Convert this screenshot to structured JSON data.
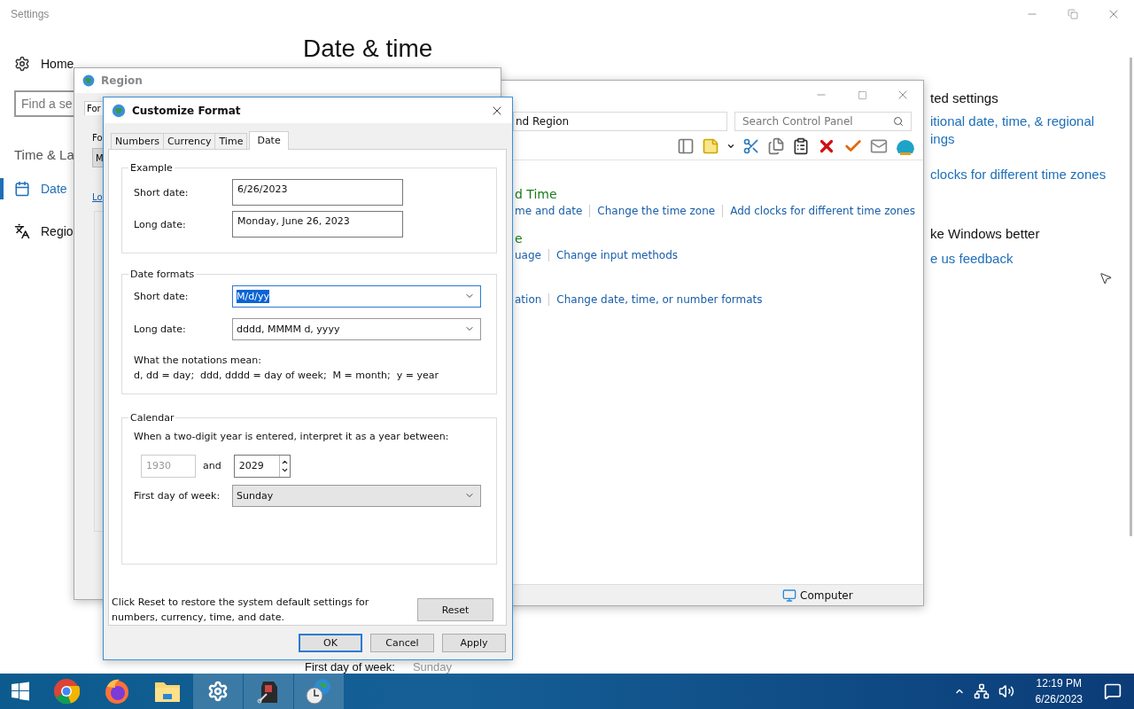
{
  "settings": {
    "title": "Settings",
    "home": "Home",
    "search_placeholder": "Find a se",
    "section": "Time & La",
    "nav": [
      {
        "kind": "calendar",
        "label": "Date",
        "selected": true
      },
      {
        "kind": "language",
        "label": "Regio",
        "selected": false
      }
    ],
    "heading": "Date & time",
    "behind_row": {
      "label": "First day of week:",
      "value": "Sunday"
    },
    "related": {
      "heading": "ted settings",
      "links": [
        "itional date, time, & regional ings",
        "clocks for different time zones"
      ]
    },
    "feedback": {
      "heading": "ke Windows better",
      "link": "e us feedback"
    }
  },
  "control_panel": {
    "address": "nd Region",
    "search_placeholder": "Search Control Panel",
    "categories": [
      {
        "heading": "d Time",
        "links": [
          "me and date",
          "Change the time zone",
          "Add clocks for different time zones"
        ]
      },
      {
        "heading": "e",
        "links": [
          "uage",
          "Change input methods"
        ]
      },
      {
        "links": [
          "ation",
          "Change date, time, or number formats"
        ]
      }
    ],
    "status": "Computer"
  },
  "region": {
    "title": "Region",
    "tab": "For",
    "label": "Fo",
    "combo_value": "M",
    "link": "Lo"
  },
  "customize": {
    "title": "Customize Format",
    "tabs": [
      {
        "label": "Numbers",
        "selected": false
      },
      {
        "label": "Currency",
        "selected": false
      },
      {
        "label": "Time",
        "selected": false
      },
      {
        "label": "Date",
        "selected": true
      }
    ],
    "example": {
      "legend": "Example",
      "rows": [
        {
          "label": "Short date:",
          "value": "6/26/2023"
        },
        {
          "label": "Long date:",
          "value": "Monday, June 26, 2023"
        }
      ]
    },
    "formats": {
      "legend": "Date formats",
      "rows": [
        {
          "label": "Short date:",
          "value": "M/d/yy",
          "focused": true
        },
        {
          "label": "Long date:",
          "value": "dddd, MMMM d, yyyy",
          "focused": false
        }
      ],
      "note_title": "What the notations mean:",
      "note": "d, dd = day;  ddd, dddd = day of week;  M = month;  y = year"
    },
    "calendar": {
      "legend": "Calendar",
      "prompt": "When a two-digit year is entered, interpret it as a year between:",
      "from_year": {
        "value": "1930",
        "disabled": true
      },
      "and_label": "and",
      "to_year": "2029",
      "first_day_label": "First day of week:",
      "first_day": "Sunday"
    },
    "reset_note": "Click Reset to restore the system default settings for numbers, currency, time, and date.",
    "reset": "Reset",
    "buttons": [
      {
        "label": "OK",
        "default": true
      },
      {
        "label": "Cancel",
        "default": false
      },
      {
        "label": "Apply",
        "default": false
      }
    ]
  },
  "taskbar": {
    "apps": [
      {
        "kind": "start",
        "active": false
      },
      {
        "kind": "chrome",
        "active": false
      },
      {
        "kind": "firefox",
        "active": false
      },
      {
        "kind": "folder",
        "active": false
      },
      {
        "kind": "gear",
        "active": true
      },
      {
        "kind": "tool",
        "active": true
      },
      {
        "kind": "clock",
        "active": true
      }
    ],
    "time": "12:19 PM",
    "date": "6/26/2023"
  }
}
